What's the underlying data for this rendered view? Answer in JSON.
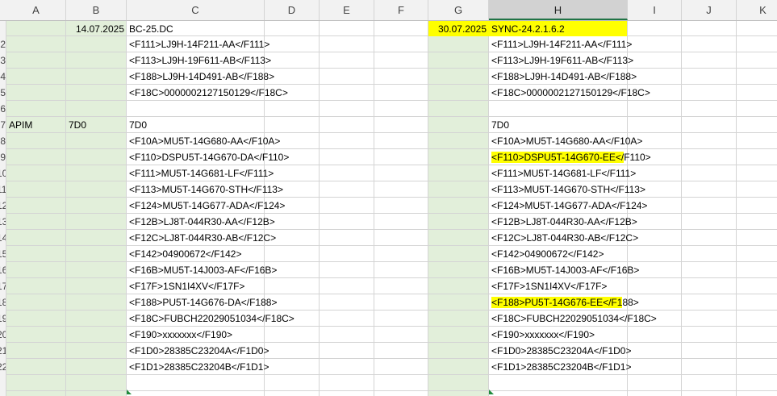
{
  "columns": [
    "A",
    "B",
    "C",
    "D",
    "E",
    "F",
    "G",
    "H",
    "I",
    "J",
    "K"
  ],
  "selected_column": "H",
  "row_numbers": [
    "2",
    "3",
    "4",
    "5",
    "6",
    "7",
    "8",
    "9",
    "10",
    "11",
    "12",
    "13",
    "14",
    "15",
    "16",
    "17",
    "18",
    "19",
    "20",
    "21",
    "22",
    ""
  ],
  "colors": {
    "green_fill": "#e2efda",
    "highlight": "#ffff00",
    "grid": "#d4d4d4"
  },
  "header_row": {
    "b1": "14.07.2025",
    "c1": "BC-25.DC",
    "g1": "30.07.2025",
    "h1": "SYNC-24.2.1.6.2"
  },
  "apim_row": {
    "a": "APIM",
    "b": "7D0"
  },
  "col_c": [
    "<F111>LJ9H-14F211-AA</F111>",
    "<F113>LJ9H-19F611-AB</F113>",
    "<F188>LJ9H-14D491-AB</F188>",
    "<F18C>0000002127150129</F18C>",
    "",
    "7D0",
    "<F10A>MU5T-14G680-AA</F10A>",
    "<F110>DSPU5T-14G670-DA</F110>",
    "<F111>MU5T-14G681-LF</F111>",
    "<F113>MU5T-14G670-STH</F113>",
    "<F124>MU5T-14G677-ADA</F124>",
    "<F12B>LJ8T-044R30-AA</F12B>",
    "<F12C>LJ8T-044R30-AB</F12C>",
    "<F142>04900672</F142>",
    "<F16B>MU5T-14J003-AF</F16B>",
    "<F17F>1SN1I4XV</F17F>",
    "<F188>PU5T-14G676-DA</F188>",
    "<F18C>FUBCH22029051034</F18C>",
    "<F190>xxxxxxx</F190>",
    "<F1D0>28385C23204A</F1D0>",
    "<F1D1>28385C23204B</F1D1>"
  ],
  "col_h": [
    "<F111>LJ9H-14F211-AA</F111>",
    "<F113>LJ9H-19F611-AB</F113>",
    "<F188>LJ9H-14D491-AB</F188>",
    "<F18C>0000002127150129</F18C>",
    "",
    "7D0",
    "<F10A>MU5T-14G680-AA</F10A>",
    "<F110>DSPU5T-14G670-EE</F110>",
    "<F111>MU5T-14G681-LF</F111>",
    "<F113>MU5T-14G670-STH</F113>",
    "<F124>MU5T-14G677-ADA</F124>",
    "<F12B>LJ8T-044R30-AA</F12B>",
    "<F12C>LJ8T-044R30-AB</F12C>",
    "<F142>04900672</F142>",
    "<F16B>MU5T-14J003-AF</F16B>",
    "<F17F>1SN1I4XV</F17F>",
    "<F188>PU5T-14G676-EE</F188>",
    "<F18C>FUBCH22029051034</F18C>",
    "<F190>xxxxxxx</F190>",
    "<F1D0>28385C23204A</F1D0>",
    "<F1D1>28385C23204B</F1D1>"
  ],
  "h_highlights": [
    {
      "row_index": 7,
      "highlighted_part": "<F110>DSPU5T-14G670-EE</",
      "rest": "F110>"
    },
    {
      "row_index": 16,
      "highlighted_part": "<F188>PU5T-14G676-EE</F1",
      "rest": "88>"
    }
  ]
}
